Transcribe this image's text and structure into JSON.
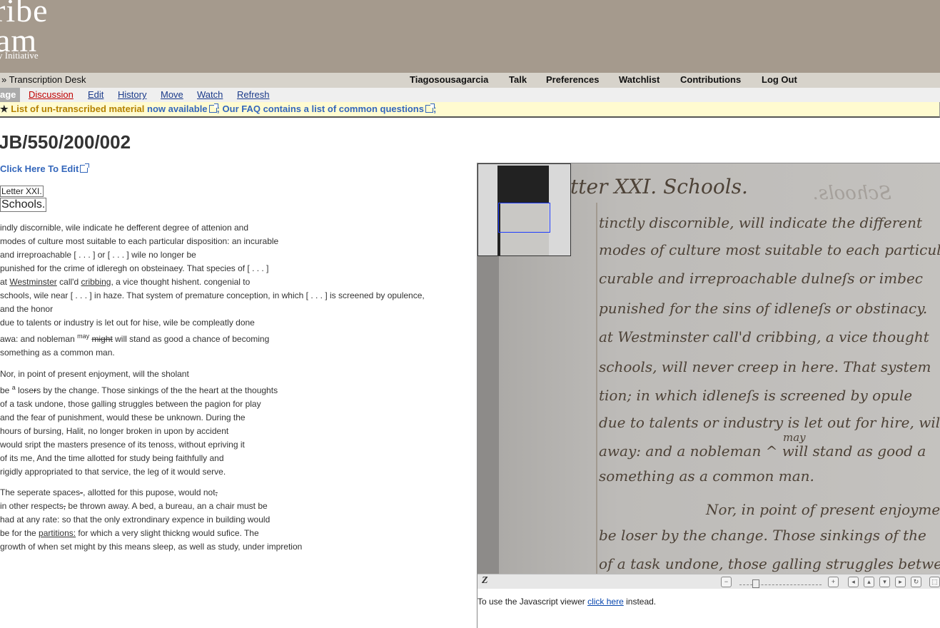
{
  "logo": {
    "line1": "ribe",
    "line2": "am",
    "line3": "y Initiative"
  },
  "userbar": {
    "breadcrumb": "» Transcription Desk",
    "links": [
      "Tiagosousagarcia",
      "Talk",
      "Preferences",
      "Watchlist",
      "Contributions",
      "Log Out"
    ]
  },
  "tabs": {
    "current": "age",
    "discussion": "Discussion",
    "edit": "Edit",
    "history": "History",
    "move": "Move",
    "watch": "Watch",
    "refresh": "Refresh"
  },
  "notice": {
    "star": "★",
    "link1": "List of un-transcribed material",
    "text1": "now available",
    "sep": ";",
    "link2": "Our FAQ contains a list of common questions",
    "end": ";"
  },
  "page": {
    "title": "JB/550/200/002",
    "edit_link": "Click Here To Edit"
  },
  "transcript": {
    "heading_letter": "Letter XXI.",
    "heading_title": "Schools.",
    "p1": {
      "l1": "indly discornible, wile indicate he defferent degree of attenion and",
      "l2": "modes of culture most suitable to each particular disposition: an incurable",
      "l3": "and irreproachable [ . . . ] or [ . . . ] wile no longer be",
      "l4": "punished for the crime of idleregh on obsteinaey. That species of [ . . . ]",
      "l5a": "at ",
      "l5b": "Westminster",
      "l5c": " call'd ",
      "l5d": "cribbing",
      "l5e": ", a vice thought hishent. congenial to",
      "l6": "schools, wile near [ . . . ] in haze. That system of premature conception, in which [ . . . ] is screened by opulence,",
      "l7": "and the honor",
      "l8": "due to talents or industry is let out for hise, wile be compleatly done",
      "l9a": "awa: and nobleman ",
      "l9b": "may",
      "l9c": " ",
      "l9d": "might",
      "l9e": " will stand as good a chance of becoming",
      "l10": "something as a common man."
    },
    "p2": {
      "l1": "Nor, in point of present enjoyment, will the sholant",
      "l2a": "be ",
      "l2b": "a",
      "l2c": " lose",
      "l2d": "r",
      "l2e": "s by the change. Those sinkings of the the heart at the thoughts",
      "l3": "of a task undone, those galling struggles between the pagion for play",
      "l4": "and the fear of punishment, would these be unknown. During the",
      "l5": "hours of bursing, Halit, no longer broken in upon by accident",
      "l6": "would sript the masters presence of its tenoss, without epriving it",
      "l7": "of its me, And the time allotted for study being faithfully and",
      "l8": "rigidly appropriated to that service, the leg of it would serve."
    },
    "p3": {
      "l1a": "The seperate spaces",
      "l1b": "-",
      "l1c": ", allotted for this pupose, would not",
      "l1d": ",",
      "l2a": "in other respects",
      "l2b": ",",
      "l2c": " be thrown away. A bed, a bureau, an a chair must be",
      "l3": "had at any rate: so that the only extrondinary expence in building would",
      "l4a": "be for the ",
      "l4b": "partitions:",
      "l4c": " for which a very slight thickng would sufice. The",
      "l5": "growth of when set might by this means sleep, as well as study, under impretion"
    }
  },
  "viewer": {
    "script_lines": [
      "tter XXI.  Schools.",
      "tinctly discornible, will indicate the different",
      "modes of culture most suitable to each particular",
      "curable and irreproachable dulneſs or imbec",
      "punished for the sins of idleneſs or obstinacy.",
      "at Westminster call'd cribbing, a vice thought",
      "schools, will never creep in here.  That system",
      "tion; in which idleneſs is screened by opule",
      "due to talents or industry is let out for hire, will",
      "away: and a nobleman  ^  will stand as good a",
      "something as a common man.",
      "Nor, in point of present enjoymen",
      "be loser by the change.  Those sinkings of the",
      "of a task undone, those galling struggles between"
    ],
    "faint_text": "Schools.",
    "insert_word": "may",
    "zoomify_label": "Z",
    "controls": [
      "−",
      "+",
      "◂",
      "▴",
      "▾",
      "▸",
      "↻",
      "⬚"
    ],
    "note_before": "To use the Javascript viewer ",
    "note_link": "click here",
    "note_after": " instead."
  }
}
